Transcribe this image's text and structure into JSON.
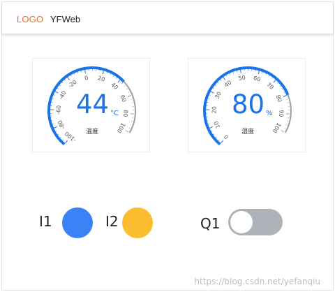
{
  "header": {
    "logo_text": "LOGO",
    "site_name": "YFWeb",
    "logo_color": "#f26b1d"
  },
  "gauges": {
    "temperature": {
      "value": "44",
      "unit": "°C",
      "label": "温度",
      "min": -100,
      "max": 100,
      "ticks": [
        "-100",
        "-80",
        "-60",
        "-40",
        "-20",
        "0",
        "20",
        "40",
        "60",
        "80",
        "100"
      ],
      "active_color": "#1a73e8",
      "inactive_color": "#9e9e9e",
      "value_color": "#1a73e8"
    },
    "humidity": {
      "value": "80",
      "unit": "%",
      "label": "湿度",
      "min": 0,
      "max": 100,
      "ticks": [
        "0",
        "10",
        "20",
        "30",
        "40",
        "50",
        "60",
        "70",
        "80",
        "90",
        "100"
      ],
      "active_color": "#1a73e8",
      "inactive_color": "#9e9e9e",
      "value_color": "#1a73e8"
    }
  },
  "io": {
    "i1": {
      "label": "I1",
      "color": "#3b82f6"
    },
    "i2": {
      "label": "I2",
      "color": "#fbbc2e"
    },
    "q1": {
      "label": "Q1",
      "state": "off",
      "track_color": "#adb3b8"
    }
  },
  "watermark": "https://blog.csdn.net/yefanqiu"
}
